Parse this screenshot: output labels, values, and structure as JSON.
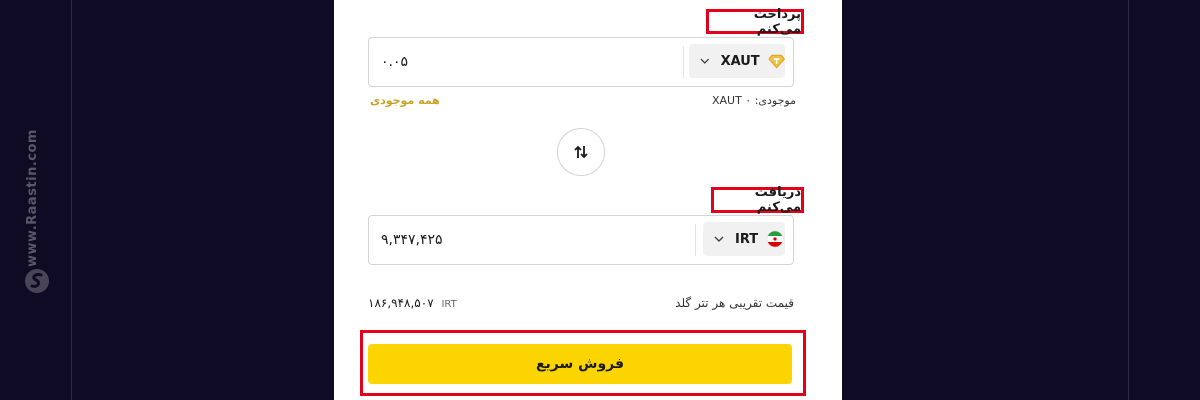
{
  "watermark": {
    "text": "www.Raastin.com"
  },
  "pay": {
    "label": "پرداخت می‌کنم",
    "amount": "۰.۰۵",
    "currency": "XAUT",
    "balance_label": "موجودی:",
    "balance_value": "XAUT ۰",
    "all_balance": "همه موجودی"
  },
  "receive": {
    "label": "دریافت می‌کنم",
    "amount": "۹,۳۴۷,۴۲۵",
    "currency": "IRT"
  },
  "price": {
    "label": "قیمت تقریبی هر تتر گلد",
    "value": "۱۸۶,۹۴۸,۵۰۷",
    "unit": "IRT"
  },
  "actions": {
    "sell_label": "فروش سریع"
  },
  "icons": {
    "pay_currency": "gold-diamond-icon",
    "receive_currency": "iran-flag-icon",
    "swap": "swap-arrows-icon",
    "dropdown": "chevron-down-icon"
  },
  "colors": {
    "accent": "#fcd500",
    "highlight": "#e3001b",
    "link": "#c9a227",
    "background": "#0f0b24"
  }
}
